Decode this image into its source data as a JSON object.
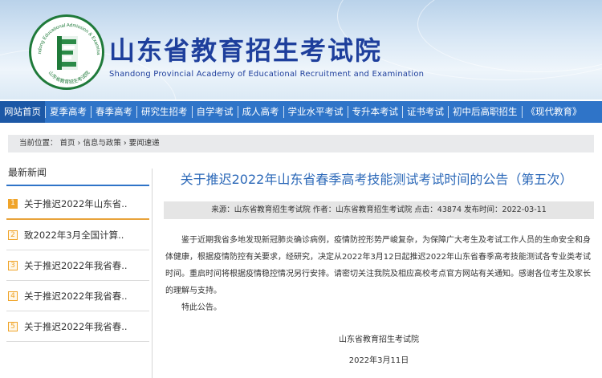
{
  "header": {
    "title_cn": "山东省教育招生考试院",
    "title_en": "Shandong Provincial Academy of Educational Recruitment and Examination",
    "logo_arc_text": "Shandong Educational Admission & Examination",
    "logo_bottom_text": "山东省教育招生考试院"
  },
  "nav": {
    "items": [
      "网站首页",
      "夏季高考",
      "春季高考",
      "研究生招考",
      "自学考试",
      "成人高考",
      "学业水平考试",
      "专升本考试",
      "证书考试",
      "初中后高职招生",
      "《现代教育》"
    ]
  },
  "breadcrumb": {
    "label": "当前位置：",
    "items": [
      "首页",
      "信息与政策",
      "要闻速递"
    ],
    "separator": "›"
  },
  "sidebar": {
    "title": "最新新闻",
    "items": [
      {
        "num": "1",
        "text": "关于推迟2022年山东省.."
      },
      {
        "num": "2",
        "text": "致2022年3月全国计算.."
      },
      {
        "num": "3",
        "text": "关于推迟2022年我省春.."
      },
      {
        "num": "4",
        "text": "关于推迟2022年我省春.."
      },
      {
        "num": "5",
        "text": "关于推迟2022年我省春.."
      }
    ]
  },
  "article": {
    "title": "关于推迟2022年山东省春季高考技能测试考试时间的公告（第五次）",
    "meta": "来源：山东省教育招生考试院 作者：山东省教育招生考试院 点击：43874 发布时间：2022-03-11",
    "paragraph": "鉴于近期我省多地发现新冠肺炎确诊病例，疫情防控形势严峻复杂，为保障广大考生及考试工作人员的生命安全和身体健康，根据疫情防控有关要求，经研究，决定从2022年3月12日起推迟2022年山东省春季高考技能测试各专业类考试时间。重启时间将根据疫情稳控情况另行安排。请密切关注我院及相应高校考点官方网站有关通知。感谢各位考生及家长的理解与支持。",
    "notice": "特此公告。",
    "signature": "山东省教育招生考试院",
    "date": "2022年3月11日"
  },
  "colors": {
    "brand_blue": "#1e3f9c",
    "nav_blue": "#2f74c8",
    "title_blue": "#2b68b8",
    "badge_orange": "#f0a429"
  }
}
